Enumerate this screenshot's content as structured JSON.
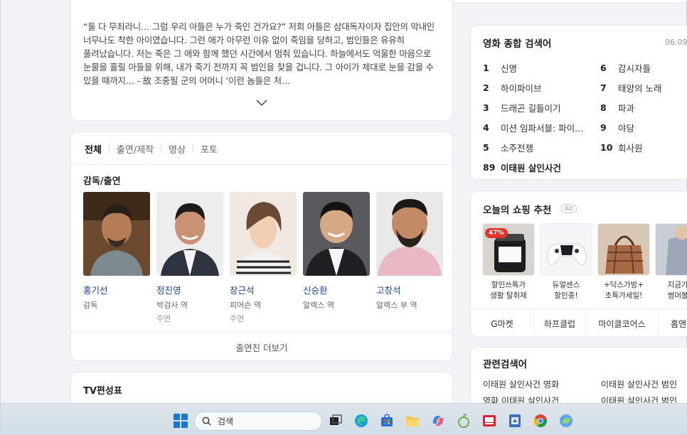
{
  "synopsis": {
    "text": "“둘 다 무죄라니… 그럼 우리 아들은 누가 죽인 건가요?” 저희 아들은 삼대독자이자 집안의 막내인 너무나도 착한 아이였습니다. 그런 애가 아무런 이유 없이 죽임을 당하고, 범인들은 유유히 풀려났습니다. 저는 죽은 그 애와 함께 했던 시간에서 멈춰 있습니다. 하늘에서도 억울한 마음으로 눈물을 흘릴 아들을 위해, 내가 죽기 전까지 꼭 범인을 찾을 겁니다. 그 아이가 제대로 눈을 감을 수 있을 때까지… - 故 조중필 군의 어머니 ‘이런 놈들은 처…"
  },
  "cast": {
    "tabs": [
      "전체",
      "출연/제작",
      "영상",
      "포토"
    ],
    "section_title": "감독/출연",
    "people": [
      {
        "name": "홍기선",
        "role": "감독",
        "type": ""
      },
      {
        "name": "정진영",
        "role": "박검사 역",
        "type": "주연"
      },
      {
        "name": "장근석",
        "role": "피어슨 역",
        "type": "주연"
      },
      {
        "name": "신승환",
        "role": "알렉스 역",
        "type": ""
      },
      {
        "name": "고창석",
        "role": "알렉스 부 역",
        "type": ""
      }
    ],
    "more_label": "출연진 더보기"
  },
  "tv": {
    "title": "TV편성표"
  },
  "rank": {
    "title": "영화 종합 검색어",
    "date": "06.09.",
    "left": [
      {
        "num": "1",
        "kw": "신명"
      },
      {
        "num": "2",
        "kw": "하이파이브"
      },
      {
        "num": "3",
        "kw": "드래곤 길들이기"
      },
      {
        "num": "4",
        "kw": "미션 임파서블: 파이…"
      },
      {
        "num": "5",
        "kw": "소주전쟁"
      },
      {
        "num": "89",
        "kw": "이태원 살인사건"
      }
    ],
    "right": [
      {
        "num": "6",
        "kw": "감시자들"
      },
      {
        "num": "7",
        "kw": "태양의 노래"
      },
      {
        "num": "8",
        "kw": "파과"
      },
      {
        "num": "9",
        "kw": "야당"
      },
      {
        "num": "10",
        "kw": "회사원"
      }
    ]
  },
  "shopping": {
    "title": "오늘의 쇼핑 추천",
    "ad": "AD",
    "products": [
      {
        "line1": "할인쓰특가",
        "line2": "생활 탈취제",
        "badge": "47%"
      },
      {
        "line1": "듀얼센스",
        "line2": "할인중!",
        "badge": ""
      },
      {
        "line1": "+닥스가방+",
        "line2": "초특가세일!",
        "badge": ""
      },
      {
        "line1": "지금가장",
        "line2": "썸머블라",
        "badge": ""
      }
    ],
    "stores": [
      "G마켓",
      "하프클럽",
      "마이클코어스",
      "홈앤"
    ]
  },
  "related": {
    "title": "관련검색어",
    "items": [
      "이태원 살인사건 영화",
      "이태원 살인사건 범인",
      "영화 이태원 살인사건",
      "이태원 살인사건 범인"
    ]
  },
  "taskbar": {
    "search_placeholder": "검색",
    "apps": [
      "start-icon",
      "search-icon",
      "task-view-icon",
      "edge-icon",
      "store-icon",
      "file-explorer-icon",
      "copilot-icon",
      "app-icon",
      "mail-icon",
      "settings-icon",
      "chrome-icon",
      "app2-icon"
    ]
  }
}
